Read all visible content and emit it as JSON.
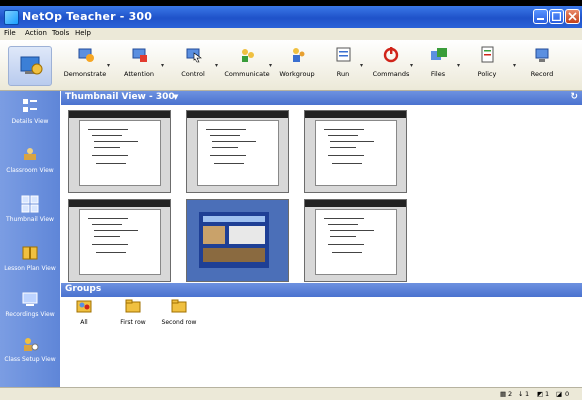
{
  "window": {
    "title": "NetOp Teacher - 300",
    "controls": [
      "minimize-icon",
      "maximize-icon",
      "close-icon"
    ]
  },
  "menu": {
    "items": [
      {
        "label": "File"
      },
      {
        "label": "Action"
      },
      {
        "label": "Tools"
      },
      {
        "label": "Help"
      }
    ]
  },
  "toolbar": {
    "buttons": [
      {
        "label": "Demonstrate",
        "icon": "demonstrate-icon"
      },
      {
        "label": "Attention",
        "icon": "attention-icon"
      },
      {
        "label": "Control",
        "icon": "control-icon"
      },
      {
        "label": "Communicate",
        "icon": "communicate-icon"
      },
      {
        "label": "Workgroup",
        "icon": "workgroup-icon"
      },
      {
        "label": "Run",
        "icon": "run-icon"
      },
      {
        "label": "Commands",
        "icon": "commands-icon"
      },
      {
        "label": "Files",
        "icon": "files-icon"
      },
      {
        "label": "Policy",
        "icon": "policy-icon"
      },
      {
        "label": "Record",
        "icon": "record-icon"
      }
    ]
  },
  "sidebar": {
    "items": [
      {
        "label": "Details View",
        "icon": "details-view-icon"
      },
      {
        "label": "Classroom View",
        "icon": "classroom-view-icon"
      },
      {
        "label": "Thumbnail View",
        "icon": "thumbnail-view-icon"
      },
      {
        "label": "Lesson Plan View",
        "icon": "lesson-plan-icon"
      },
      {
        "label": "Recordings View",
        "icon": "recordings-icon"
      },
      {
        "label": "Class Setup View",
        "icon": "class-setup-icon"
      }
    ]
  },
  "thumbnail_pane": {
    "title": "Thumbnail View - 300",
    "thumbnails": [
      {
        "kind": "document"
      },
      {
        "kind": "document"
      },
      {
        "kind": "document"
      },
      {
        "kind": "document"
      },
      {
        "kind": "webpage",
        "selected": true
      },
      {
        "kind": "document"
      }
    ]
  },
  "groups_pane": {
    "title": "Groups",
    "groups": [
      {
        "label": "All"
      },
      {
        "label": "First row"
      },
      {
        "label": "Second row"
      }
    ]
  },
  "status": {
    "items": [
      "2",
      "1",
      "1",
      "0"
    ]
  },
  "colors": {
    "title_bar": "#1f52c9",
    "sidebar": "#6a8fdc",
    "pane_header": "#4a72cf",
    "selected_thumb": "#4b6fb8"
  }
}
